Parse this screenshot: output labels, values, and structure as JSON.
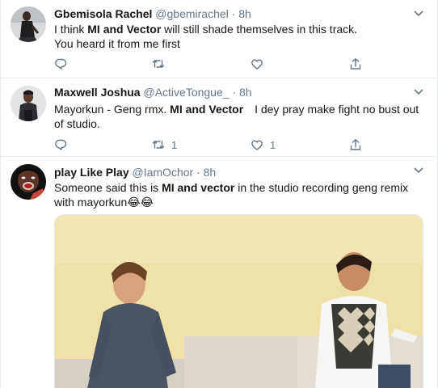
{
  "tweets": [
    {
      "name": "Gbemisola Rachel",
      "handle": "@gbemirachel",
      "dot": "·",
      "time": "8h",
      "text": {
        "p1": "I think ",
        "bold": "MI and Vector",
        "p2": " will still shade themselves in this track.",
        "line2": "You heard it from me first"
      },
      "actions": {
        "reply_count": "",
        "retweet_count": "",
        "like_count": ""
      }
    },
    {
      "name": "Maxwell Joshua",
      "handle": "@ActiveTongue_",
      "dot": "·",
      "time": "8h",
      "text": {
        "p1": "Mayorkun - Geng rmx. ",
        "bold": "MI and Vector",
        "p2": " I dey pray make fight no bust out of studio."
      },
      "actions": {
        "reply_count": "",
        "retweet_count": "1",
        "like_count": "1"
      }
    },
    {
      "name": "play Like Play",
      "handle": "@IamOchor",
      "dot": "·",
      "time": "8h",
      "text": {
        "p1": "Someone said this is ",
        "bold": "MI and vector",
        "p2": " in the studio recording geng remix with mayorkun",
        "emoji": "😂😂"
      }
    }
  ],
  "icons": {
    "reply": "reply-icon",
    "retweet": "retweet-icon",
    "like": "heart-icon",
    "share": "share-icon",
    "caret": "chevron-down-icon"
  },
  "colors": {
    "text": "#14171a",
    "secondary": "#657786",
    "border": "#e6ecf0"
  }
}
